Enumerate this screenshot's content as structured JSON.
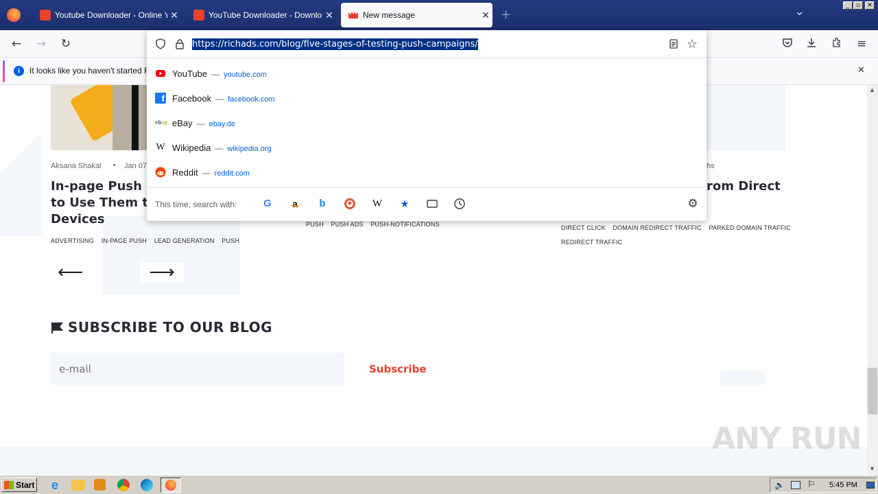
{
  "tabs": [
    {
      "label": "Youtube Downloader - Online Youtu",
      "close": "✕"
    },
    {
      "label": "YouTube Downloader - Download Y",
      "close": "✕"
    },
    {
      "label": "New message",
      "close": "✕"
    }
  ],
  "new_tab": "+",
  "tab_list": "⌄",
  "window_buttons": {
    "minimize": "_",
    "restore": "▫",
    "close": "✕"
  },
  "urlbar": {
    "url": "https://richads.com/blog/five-stages-of-testing-push-campaigns/"
  },
  "suggestions": [
    {
      "name": "YouTube",
      "domain": "youtube.com"
    },
    {
      "name": "Facebook",
      "domain": "facebook.com"
    },
    {
      "name": "eBay",
      "domain": "ebay.de"
    },
    {
      "name": "Wikipedia",
      "domain": "wikipedia.org"
    },
    {
      "name": "Reddit",
      "domain": "reddit.com"
    }
  ],
  "search_with_label": "This time, search with:",
  "search_engines": [
    "google-icon",
    "amazon-icon",
    "bing-icon",
    "duckduckgo-icon",
    "wikipedia-icon",
    "bookmarks-icon",
    "tabs-icon",
    "history-icon"
  ],
  "notification": {
    "text": "It looks like you haven't started Fire"
  },
  "articles": [
    {
      "author": "Aksana Shakal",
      "date": "Jan 07",
      "title_lines": [
        "In-page Push N",
        "to Use Them to",
        "Devices"
      ],
      "tags": [
        "ADVERTISING",
        "IN-PAGE PUSH",
        "LEAD GENERATION",
        "PUSH"
      ]
    },
    {
      "tags": [
        "PUSH",
        "PUSH ADS",
        "PUSH-NOTIFICATIONS"
      ]
    },
    {
      "date": "hs",
      "title_lines": [
        "rom Direct"
      ],
      "tags": [
        "DIRECT CLICK",
        "DOMAIN REDIRECT TRAFFIC",
        "PARKED DOMAIN TRAFFIC",
        "REDIRECT TRAFFIC"
      ]
    }
  ],
  "carousel": {
    "prev": "⟵",
    "next": "⟶"
  },
  "subscribe": {
    "heading": "SUBSCRIBE TO OUR BLOG",
    "placeholder": "e-mail",
    "button": "Subscribe"
  },
  "watermark": "ANY RUN",
  "taskbar": {
    "start": "Start",
    "time": "5:45 PM"
  },
  "colors": {
    "accent_red": "#e8412c",
    "tab_bg": "#1c2f6d",
    "link_blue": "#0061e0"
  }
}
